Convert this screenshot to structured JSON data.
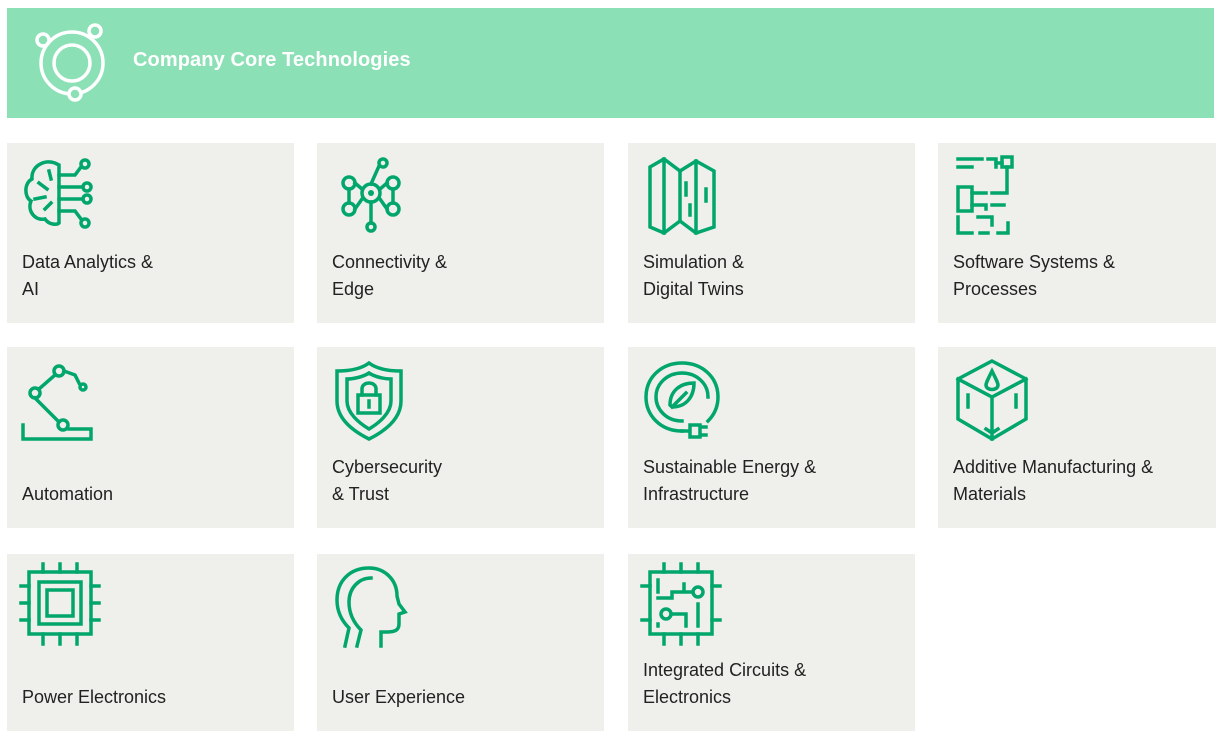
{
  "header": {
    "title": "Company Core Technologies",
    "logo_icon": "orbit-icon",
    "background": "#8be0b6"
  },
  "colors": {
    "accent": "#00a66b",
    "tile_bg": "#efefec",
    "text": "#222222"
  },
  "tiles": [
    {
      "label": "Data Analytics &\nAI",
      "icon": "brain-circuit-icon"
    },
    {
      "label": "Connectivity &\nEdge",
      "icon": "network-hub-icon"
    },
    {
      "label": "Simulation &\nDigital Twins",
      "icon": "folded-map-icon"
    },
    {
      "label": "Software Systems &\nProcesses",
      "icon": "flowchart-icon"
    },
    {
      "label": "Automation",
      "icon": "robot-arm-icon"
    },
    {
      "label": "Cybersecurity\n& Trust",
      "icon": "shield-lock-icon"
    },
    {
      "label": "Sustainable Energy &\nInfrastructure",
      "icon": "leaf-plug-icon"
    },
    {
      "label": "Additive Manufacturing &\nMaterials",
      "icon": "cube-drop-icon"
    },
    {
      "label": "Power Electronics",
      "icon": "chip-icon"
    },
    {
      "label": "User Experience",
      "icon": "human-head-icon"
    },
    {
      "label": "Integrated Circuits &\nElectronics",
      "icon": "circuit-board-icon"
    }
  ]
}
